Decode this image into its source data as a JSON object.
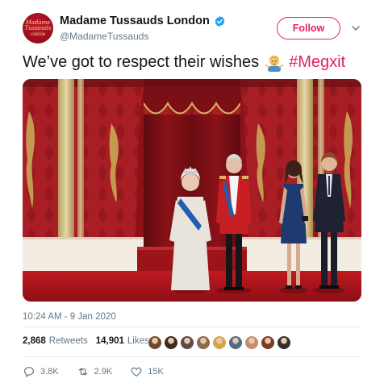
{
  "account": {
    "display_name": "Madame Tussauds London",
    "handle": "@MadameTussauds",
    "avatar_text": "Madame Tussauds",
    "avatar_subtext": "LONDON",
    "verified": true
  },
  "follow_label": "Follow",
  "tweet": {
    "text": "We’ve got to respect their wishes",
    "emoji": "man-shrugging-emoji",
    "hashtag": "#Megxit"
  },
  "timestamp": "10:24 AM - 9 Jan 2020",
  "stats": {
    "retweets_count": "2,868",
    "retweets_label": "Retweets",
    "likes_count": "14,901",
    "likes_label": "Likes"
  },
  "actions": {
    "replies": "3.8K",
    "retweets": "2.9K",
    "likes": "15K"
  },
  "colors": {
    "accent": "#e0245e",
    "verified": "#1da1f2",
    "text_secondary": "#657786",
    "wall_red": "#a61c22",
    "carpet_red": "#b0141b"
  },
  "liker_colors": [
    "#6b4a2f",
    "#3d2b22",
    "#5a4a42",
    "#8a6a4a",
    "#d9a24a",
    "#4d6a8a",
    "#c98a6a",
    "#7a3b2b",
    "#2f2f2f"
  ]
}
